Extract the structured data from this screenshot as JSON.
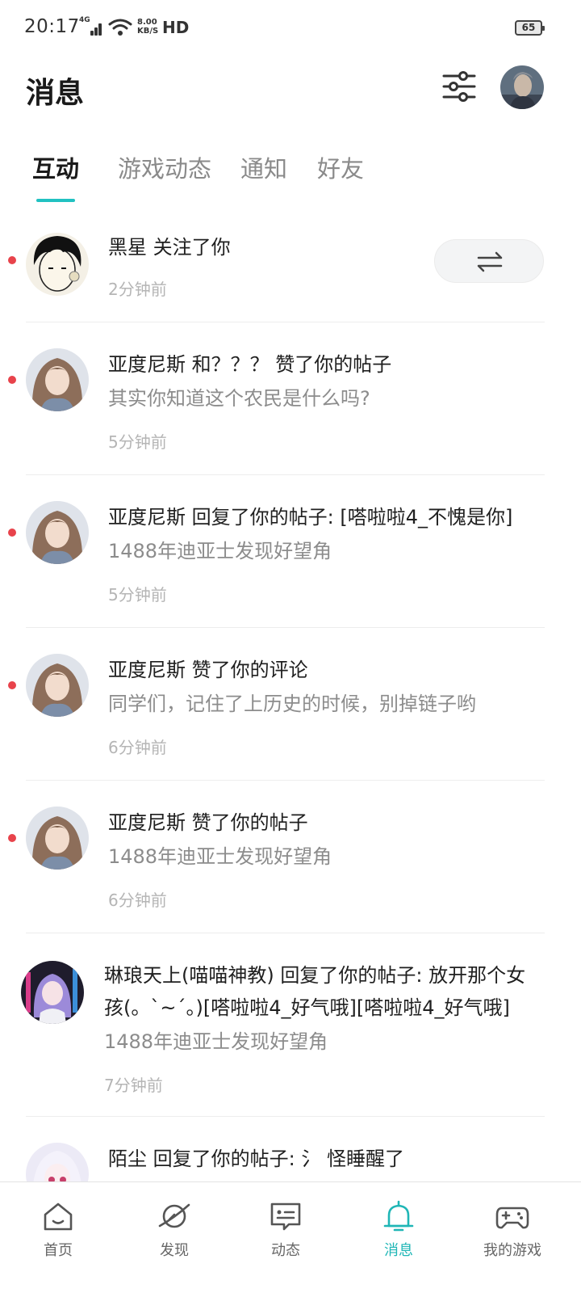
{
  "status_bar": {
    "time": "20:17",
    "network": "4G",
    "speed_value": "8.00",
    "speed_unit": "KB/S",
    "hd": "HD",
    "battery": "65"
  },
  "header": {
    "title": "消息",
    "filter_icon": "sliders-icon",
    "avatar_icon": "user-avatar"
  },
  "tabs": [
    {
      "label": "互动",
      "active": true
    },
    {
      "label": "游戏动态",
      "active": false
    },
    {
      "label": "通知",
      "active": false
    },
    {
      "label": "好友",
      "active": false
    }
  ],
  "messages": [
    {
      "title": "黑星 关注了你",
      "subtitle": "",
      "time": "2分钟前",
      "unread": true,
      "action_icon": "swap-arrows-icon"
    },
    {
      "title": "亚度尼斯 和？？？ 赞了你的帖子",
      "subtitle": "其实你知道这个农民是什么吗?",
      "time": "5分钟前",
      "unread": true
    },
    {
      "title": "亚度尼斯 回复了你的帖子: [嗒啦啦4_不愧是你]",
      "subtitle": "1488年迪亚士发现好望角",
      "time": "5分钟前",
      "unread": true
    },
    {
      "title": "亚度尼斯 赞了你的评论",
      "subtitle": "同学们，记住了上历史的时候，别掉链子哟",
      "time": "6分钟前",
      "unread": true
    },
    {
      "title": "亚度尼斯 赞了你的帖子",
      "subtitle": "1488年迪亚士发现好望角",
      "time": "6分钟前",
      "unread": true
    },
    {
      "title_line1": "琳琅天上(喵喵神教) 回复了你的帖子: 放开那个女",
      "title_line2": "孩(。`~´。)[嗒啦啦4_好气哦][嗒啦啦4_好气哦]",
      "subtitle": "1488年迪亚士发现好望角",
      "time": "7分钟前",
      "unread": false
    },
    {
      "title": "陌尘 回复了你的帖子: 氵 怪睡醒了",
      "unread": false
    }
  ],
  "bottom_nav": [
    {
      "label": "首页",
      "icon": "home-icon",
      "active": false
    },
    {
      "label": "发现",
      "icon": "planet-icon",
      "active": false
    },
    {
      "label": "动态",
      "icon": "chat-card-icon",
      "active": false
    },
    {
      "label": "消息",
      "icon": "bell-icon",
      "active": true
    },
    {
      "label": "我的游戏",
      "icon": "gamepad-icon",
      "active": false
    }
  ],
  "colors": {
    "accent": "#21c1c1",
    "unread_dot": "#e8434b",
    "muted_text": "#8c8c8c"
  }
}
